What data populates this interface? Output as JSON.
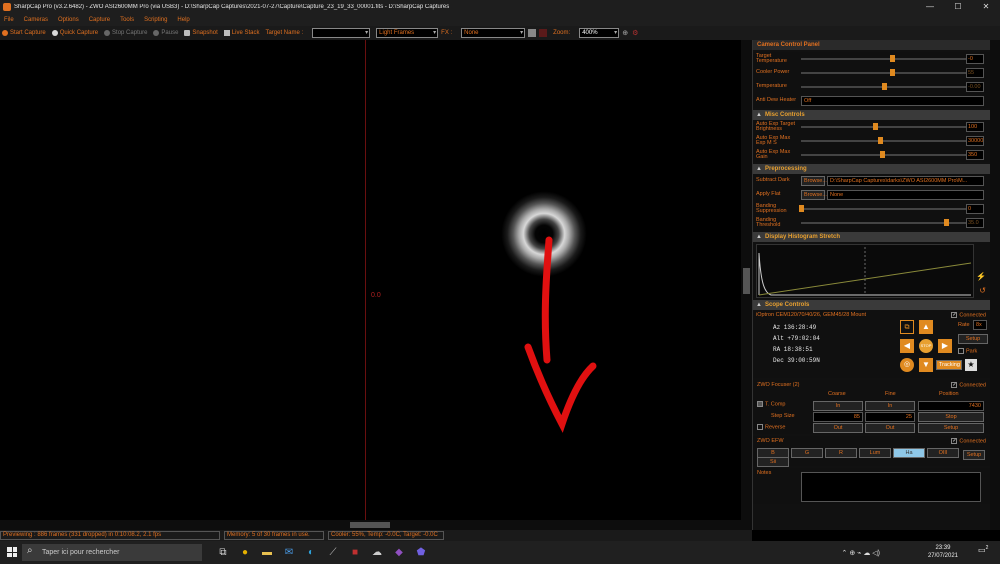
{
  "window": {
    "title": "SharpCap Pro (v3.2.6482) - ZWO ASI2600MM Pro (via USB3) - D:\\SharpCap Captures\\2021-07-27\\Capture\\Capture_23_19_33_00001.fits - D:\\SharpCap Captures",
    "minimize": "—",
    "maximize": "☐",
    "close": "✕"
  },
  "menu": [
    "File",
    "Cameras",
    "Options",
    "Capture",
    "Tools",
    "Scripting",
    "Help"
  ],
  "toolbar": {
    "start_capture": "Start Capture",
    "quick_capture": "Quick Capture",
    "stop_capture": "Stop Capture",
    "pause": "Pause",
    "snapshot": "Snapshot",
    "live_stack": "Live Stack",
    "target_name_label": "Target Name :",
    "target_name_value": "",
    "frame_type": "Light Frames",
    "fx_label": "FX :",
    "fx_value": "None",
    "zoom_label": "Zoom:",
    "zoom_value": "400%"
  },
  "viewport": {
    "line_label": "0.0"
  },
  "status": {
    "previewing": "Previewing : 886 frames (331 dropped) in 0:10:08.2, 2.1 fps",
    "memory": "Memory: 5 of 30 frames in use.",
    "cooler": "Cooler: 55%, Temp: -0.0C, Target: -0.0C"
  },
  "panel": {
    "header": "Camera Control Panel",
    "camera": {
      "rows": [
        {
          "label": "Target Temperature",
          "value": "-0",
          "level": 0.55
        },
        {
          "label": "Cooler Power",
          "value": "55",
          "level": 0.55
        },
        {
          "label": "Temperature",
          "value": "-0.00",
          "level": 0.5
        }
      ],
      "anti_dew_label": "Anti Dew Heater",
      "anti_dew_value": "Off"
    },
    "misc": {
      "title": "Misc Controls",
      "rows": [
        {
          "label": "Auto Exp Target Brightness",
          "value": "100",
          "level": 0.45
        },
        {
          "label": "Auto Exp Max Exp M S",
          "value": "30000",
          "level": 0.48
        },
        {
          "label": "Auto Exp Max Gain",
          "value": "350",
          "level": 0.49
        }
      ]
    },
    "preprocessing": {
      "title": "Preprocessing",
      "subtract_dark_label": "Subtract Dark",
      "subtract_dark_browse": "Browse...",
      "subtract_dark_value": "D:\\SharpCap Captures\\darks\\ZWO ASI2600MM Pro\\M...",
      "apply_flat_label": "Apply Flat",
      "apply_flat_browse": "Browse...",
      "apply_flat_value": "None",
      "banding_suppression_label": "Banding Suppression",
      "banding_suppression_value": "0",
      "banding_suppression_level": 0.0,
      "banding_threshold_label": "Banding Threshold",
      "banding_threshold_value": "35.0",
      "banding_threshold_level": 0.88
    },
    "histogram": {
      "title": "Display Histogram Stretch"
    },
    "scope": {
      "title": "Scope Controls",
      "mount": "iOptron CEM120/70/40/26, GEM45/28 Mount",
      "connected": "Connected",
      "az": "Az   136:28:49",
      "alt": "Alt  +79:02:04",
      "ra": "RA   18:38:51",
      "dec": "Dec  39:00:59N",
      "rate_label": "Rate",
      "rate_value": "8x",
      "setup": "Setup",
      "park": "Park",
      "tracking": "Tracking",
      "stop": "STOP"
    },
    "focuser": {
      "title": "ZWO Focuser (2)",
      "connected": "Connected",
      "coarse": "Coarse",
      "fine": "Fine",
      "position": "Position",
      "t_comp": "T. Comp",
      "in1": "In",
      "in2": "In",
      "position_value": "7430",
      "step_size": "Step Size",
      "step_coarse": "85",
      "step_fine": "25",
      "stop": "Stop",
      "reverse": "Reverse",
      "out1": "Out",
      "out2": "Out",
      "setup": "Setup"
    },
    "efw": {
      "title": "ZWO EFW",
      "connected": "Connected",
      "filters": [
        "B",
        "G",
        "R",
        "Lum",
        "Ha",
        "OIII",
        "Sii"
      ],
      "selected": "Ha",
      "setup": "Setup"
    },
    "notes": {
      "title": "Notes"
    }
  },
  "taskbar": {
    "search_placeholder": "Taper ici pour rechercher",
    "time": "23:39",
    "date": "27/07/2021",
    "notifications": "2"
  }
}
